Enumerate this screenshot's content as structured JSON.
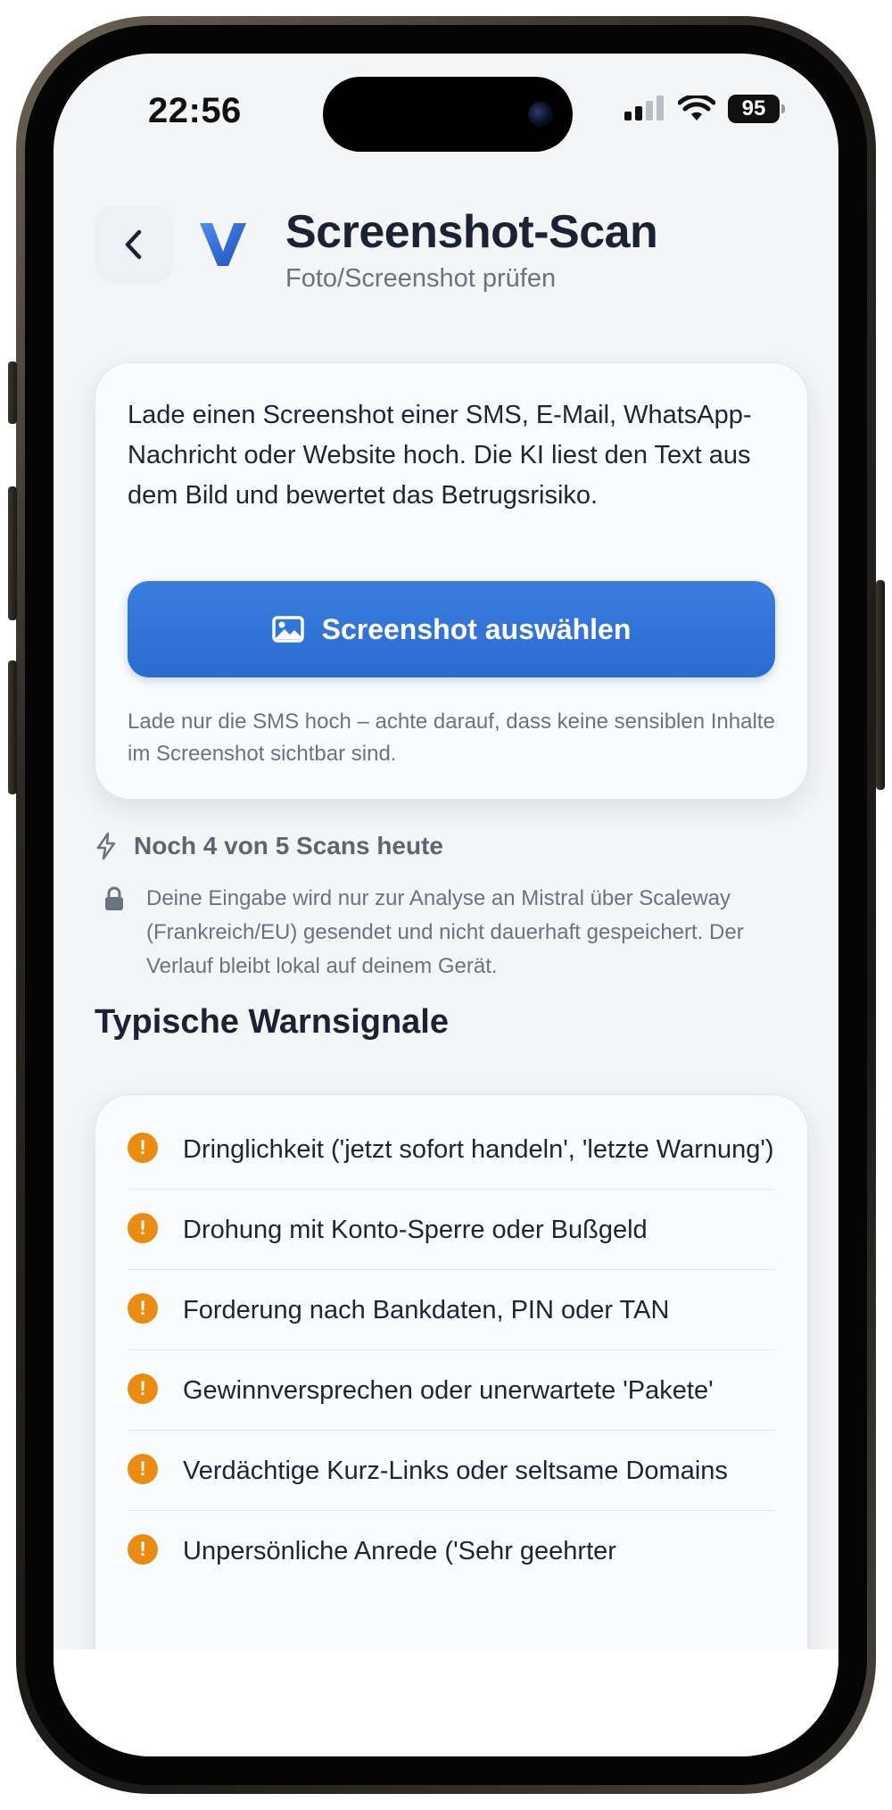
{
  "status_bar": {
    "time": "22:56",
    "battery": "95",
    "signal_icon": "signal-bars-icon",
    "wifi_icon": "wifi-icon"
  },
  "header": {
    "back_icon": "chevron-left-icon",
    "logo_icon": "app-logo-v-icon",
    "title": "Screenshot-Scan",
    "subtitle": "Foto/Screenshot prüfen"
  },
  "upload": {
    "intro": "Lade einen Screenshot einer SMS, E-Mail, WhatsApp-Nachricht oder Website hoch. Die KI liest den Text aus dem Bild und bewertet das Betrugsrisiko.",
    "button_label": "Screenshot auswählen",
    "button_icon": "image-icon",
    "hint": "Lade nur die SMS hoch – achte darauf, dass keine sensiblen Inhalte im Screenshot sichtbar sind."
  },
  "quota": {
    "icon": "lightning-icon",
    "text": "Noch 4 von 5 Scans heute"
  },
  "privacy": {
    "icon": "lock-icon",
    "text": "Deine Eingabe wird nur zur Analyse an Mistral über Scaleway (Frankreich/EU) gesendet und nicht dauerhaft gespeichert. Der Verlauf bleibt lokal auf deinem Gerät."
  },
  "warnings": {
    "title": "Typische Warnsignale",
    "badge_symbol": "!",
    "accent_color": "#ea8c12",
    "items": [
      {
        "text": "Dringlichkeit ('jetzt sofort handeln', 'letzte Warnung')"
      },
      {
        "text": "Drohung mit Konto-Sperre oder Bußgeld"
      },
      {
        "text": "Forderung nach Bankdaten, PIN oder TAN"
      },
      {
        "text": "Gewinnversprechen oder unerwartete 'Pakete'"
      },
      {
        "text": "Verdächtige Kurz-Links oder seltsame Domains"
      },
      {
        "text": "Unpersönliche Anrede ('Sehr geehrter"
      }
    ]
  },
  "colors": {
    "primary": "#2a6bd2",
    "background": "#f4f5f7",
    "text": "#1a2233",
    "muted": "#6b7280"
  }
}
